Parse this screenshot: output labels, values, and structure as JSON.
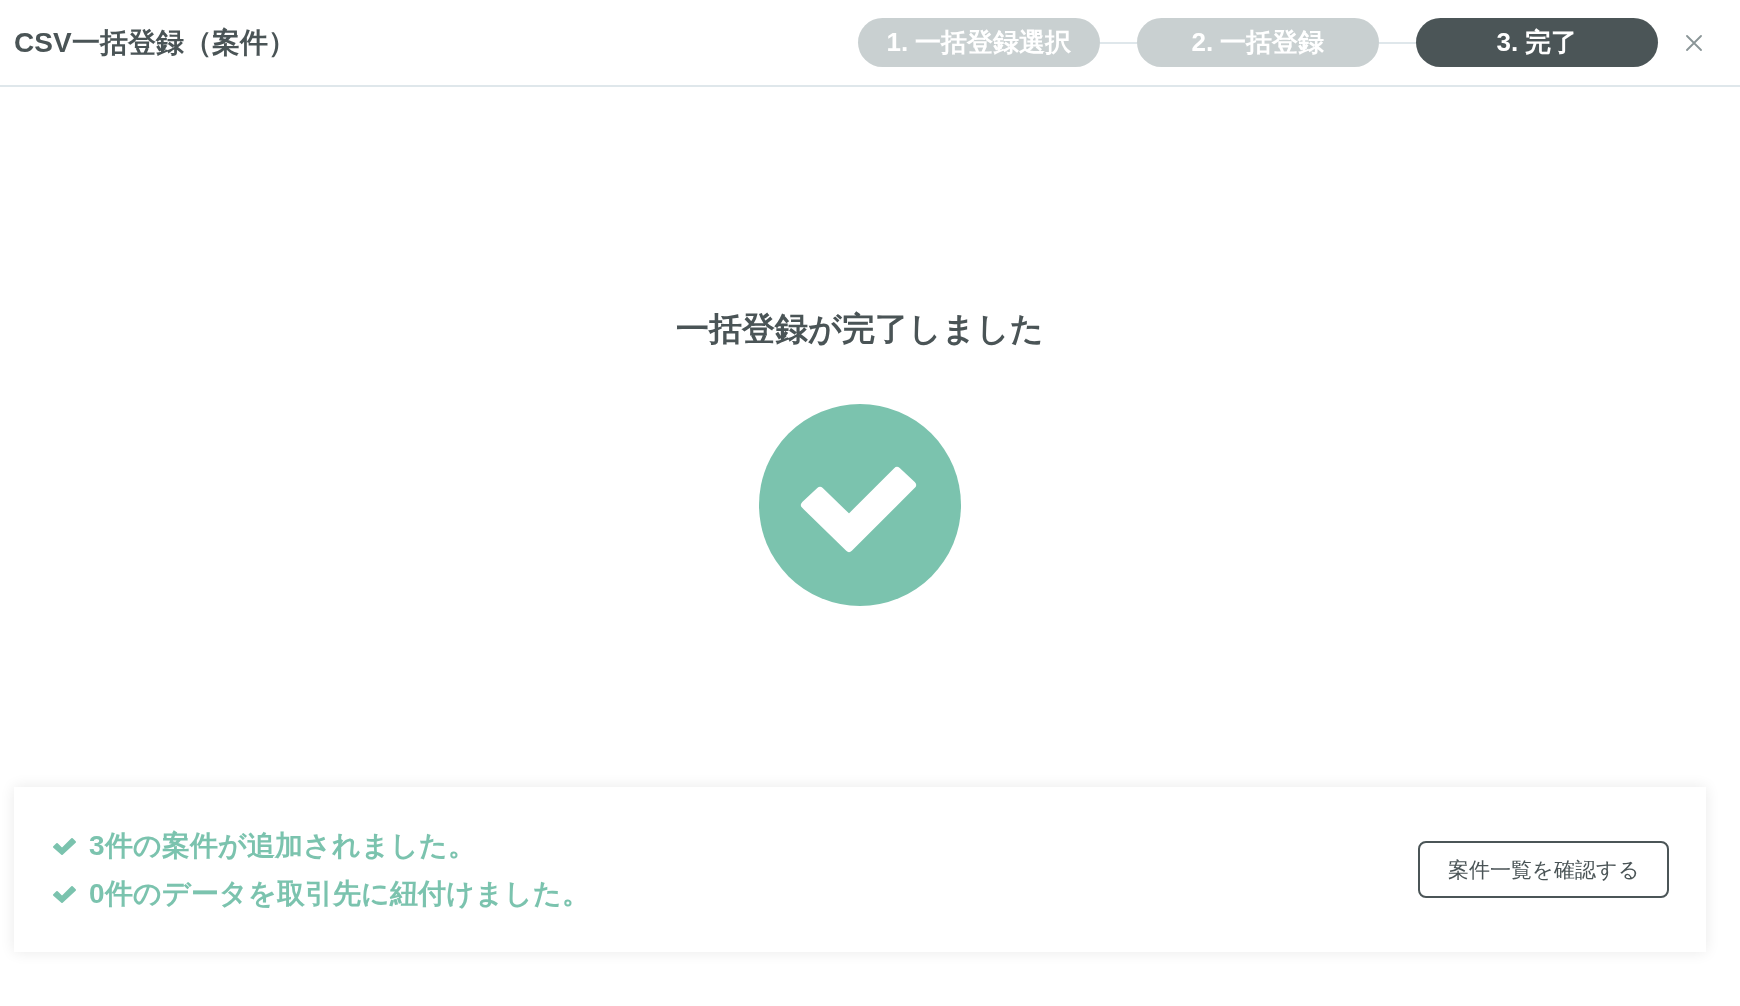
{
  "header": {
    "title": "CSV一括登録（案件）",
    "steps": [
      {
        "label": "1. 一括登録選択",
        "selected": false
      },
      {
        "label": "2. 一括登録",
        "selected": false
      },
      {
        "label": "3. 完了",
        "selected": true
      }
    ]
  },
  "result": {
    "heading": "一括登録が完了しました"
  },
  "summary": {
    "messages": [
      "3件の案件が追加されました。",
      "0件のデータを取引先に紐付けました。"
    ],
    "button": "案件一覧を確認する"
  }
}
